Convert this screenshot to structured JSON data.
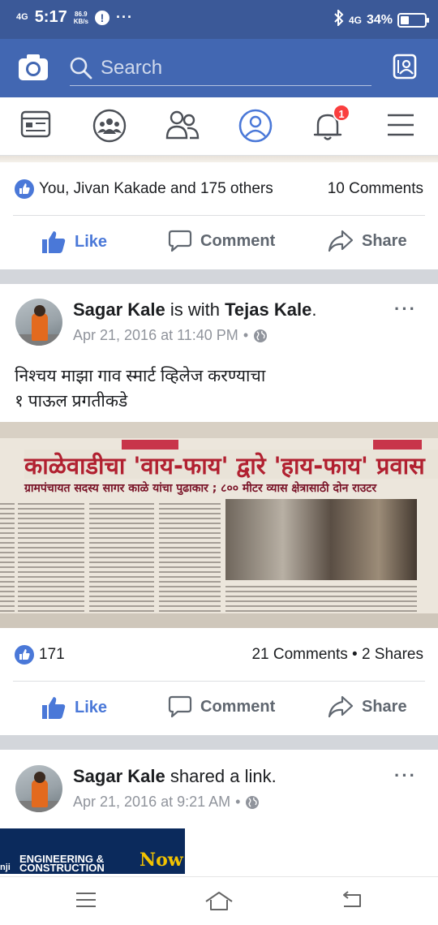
{
  "status_bar": {
    "network": "4G",
    "time": "5:17",
    "speed_value": "86.9",
    "speed_unit": "KB/s",
    "dots": "···",
    "right_network": "4G",
    "battery": "34%",
    "battery_level": 0.34
  },
  "header": {
    "search_placeholder": "Search"
  },
  "nav_tabs": {
    "notification_badge": "1"
  },
  "previous_post": {
    "reactions_text": "You, Jivan Kakade and 175 others",
    "comments_text": "10 Comments",
    "actions": {
      "like": "Like",
      "comment": "Comment",
      "share": "Share"
    }
  },
  "post1": {
    "author": "Sagar Kale",
    "connector": " is with ",
    "tagged": "Tejas Kale",
    "period": ".",
    "timestamp": "Apr 21, 2016 at 11:40 PM",
    "meta_sep": "•",
    "text_line1": "निश्चय माझा गाव स्मार्ट व्हिलेज करण्याचा",
    "text_line2": "१ पाऊल प्रगतीकडे",
    "image": {
      "headline": "काळेवाडीचा 'वाय-फाय' द्वारे 'हाय-फाय' प्रवास",
      "subheadline": "ग्रामपंचायत सदस्य सागर काळे यांचा पुढाकार ; ८०० मीटर व्यास क्षेत्रासाठी दोन राउटर"
    },
    "reaction_count": "171",
    "comments_shares": "21 Comments • 2 Shares",
    "actions": {
      "like": "Like",
      "comment": "Comment",
      "share": "Share"
    }
  },
  "post2": {
    "author": "Sagar Kale",
    "rest": " shared a link.",
    "timestamp": "Apr 21, 2016 at 9:21 AM",
    "meta_sep": "•",
    "link_image": {
      "line1": "ENGINEERING &",
      "line2": "CONSTRUCTION",
      "now": "Now",
      "left_fragment": "nji"
    }
  },
  "colors": {
    "brand_blue": "#4267b2",
    "status_blue": "#3b5998",
    "like_blue": "#4a78d8",
    "badge_red": "#fa3e3e"
  }
}
